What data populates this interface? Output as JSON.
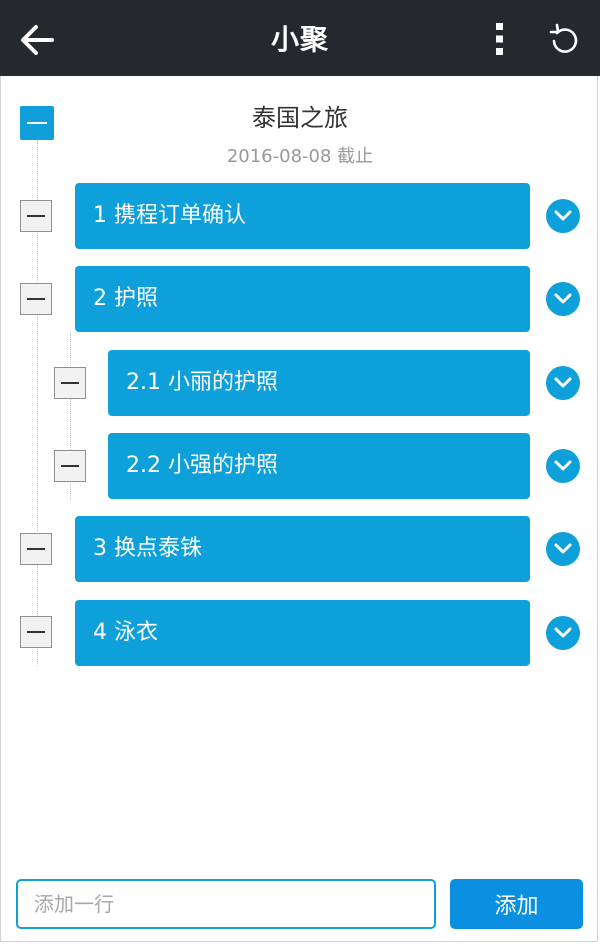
{
  "header": {
    "title": "小聚",
    "back_icon": "arrow-left-icon",
    "menu_icon": "kebab-menu-icon",
    "refresh_icon": "refresh-icon",
    "background_color": "#25292d"
  },
  "root": {
    "title": "泰国之旅",
    "date": "2016-08-08 截止",
    "toggle_color": "#119fdb"
  },
  "items": [
    {
      "label": "1 携程订单确认",
      "level": 1
    },
    {
      "label": "2 护照",
      "level": 1
    },
    {
      "label": "2.1 小丽的护照",
      "level": 2
    },
    {
      "label": "2.2 小强的护照",
      "level": 2
    },
    {
      "label": "3 换点泰铢",
      "level": 1
    },
    {
      "label": "4 泳衣",
      "level": 1
    }
  ],
  "footer": {
    "input_placeholder": "添加一行",
    "add_label": "添加"
  },
  "colors": {
    "accent": "#0ea0db",
    "button": "#0b8fe0"
  }
}
